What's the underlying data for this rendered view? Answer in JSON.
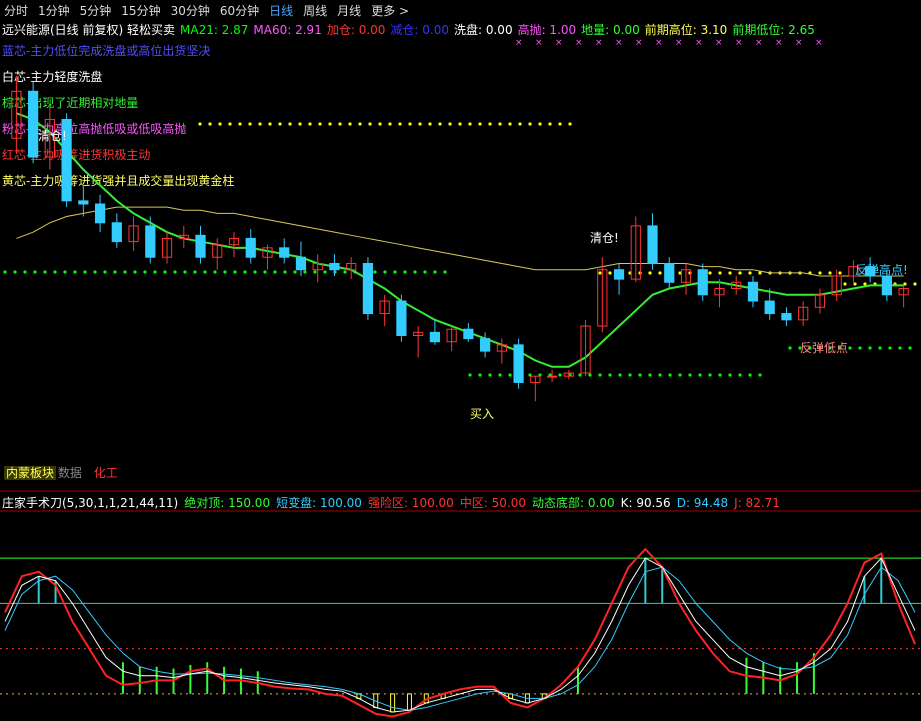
{
  "tabs": [
    "分时",
    "1分钟",
    "5分钟",
    "15分钟",
    "30分钟",
    "60分钟",
    "日线",
    "周线",
    "月线",
    "更多 >"
  ],
  "active_tab": "日线",
  "main_legend": {
    "title": "远兴能源(日线 前复权) 轻松买卖",
    "items": [
      {
        "label": "MA21: 2.87",
        "color": "#00ff00"
      },
      {
        "label": "MA60: 2.91",
        "color": "#ff55ff"
      },
      {
        "label": "加仓: 0.00",
        "color": "#ff3333"
      },
      {
        "label": "减仓: 0.00",
        "color": "#3333ff"
      },
      {
        "label": "洗盘: 0.00",
        "color": "#ffffff"
      },
      {
        "label": "高抛: 1.00",
        "color": "#ff55ff"
      },
      {
        "label": "地量: 0.00",
        "color": "#33ff33"
      },
      {
        "label": "前期高位: 3.10",
        "color": "#ffff55"
      },
      {
        "label": "前期低位: 2.65",
        "color": "#33ff33"
      }
    ]
  },
  "notes": [
    {
      "text": "蓝芯-主力低位完成洗盘或高位出货坚决",
      "color": "#4f4fff"
    },
    {
      "text": "白芯-主力轻度洗盘",
      "color": "#ffffff"
    },
    {
      "text": "棕芯-出现了近期相对地量",
      "color": "#33ee33"
    },
    {
      "text": "粉芯-主力高位高抛低吸或低吸高抛",
      "color": "#ff55ff"
    },
    {
      "text": "红芯-主力吸筹进货积极主动",
      "color": "#ff3333"
    },
    {
      "text": "黄芯-主力吸筹进货强并且成交量出现黄金柱",
      "color": "#ffff66"
    }
  ],
  "annotations": {
    "clear1": "清仓!",
    "clear2": "清仓!",
    "buy": "买入",
    "rebound_high": "反弹高点!",
    "rebound_low": "反弹低点"
  },
  "lower_tabs": {
    "t1": "内蒙板块",
    "t2": "数据",
    "t3": "化工"
  },
  "sub_legend": {
    "title": "庄家手术刀(5,30,1,1,21,44,11)",
    "items": [
      {
        "label": "绝对顶: 150.00",
        "color": "#33ff33"
      },
      {
        "label": "短变盘: 100.00",
        "color": "#33ccff"
      },
      {
        "label": "强险区: 100.00",
        "color": "#ff3333"
      },
      {
        "label": "中区: 50.00",
        "color": "#ff3333"
      },
      {
        "label": "动态底部: 0.00",
        "color": "#33ff33"
      },
      {
        "label": "K: 90.56",
        "color": "#ffffff"
      },
      {
        "label": "D: 94.48",
        "color": "#33ccff"
      },
      {
        "label": "J: 82.71",
        "color": "#ff3333"
      }
    ]
  },
  "chart_data": {
    "type": "candlestick",
    "price_candles": [
      [
        3.2,
        3.4,
        3.15,
        3.35
      ],
      [
        3.35,
        3.38,
        3.12,
        3.14
      ],
      [
        3.14,
        3.3,
        3.1,
        3.26
      ],
      [
        3.26,
        3.28,
        2.98,
        3.0
      ],
      [
        3.0,
        3.05,
        2.95,
        2.99
      ],
      [
        2.99,
        3.02,
        2.9,
        2.93
      ],
      [
        2.93,
        2.96,
        2.85,
        2.87
      ],
      [
        2.87,
        2.95,
        2.84,
        2.92
      ],
      [
        2.92,
        2.95,
        2.8,
        2.82
      ],
      [
        2.82,
        2.9,
        2.8,
        2.88
      ],
      [
        2.88,
        2.92,
        2.85,
        2.89
      ],
      [
        2.89,
        2.92,
        2.8,
        2.82
      ],
      [
        2.82,
        2.88,
        2.78,
        2.86
      ],
      [
        2.86,
        2.9,
        2.82,
        2.88
      ],
      [
        2.88,
        2.91,
        2.8,
        2.82
      ],
      [
        2.82,
        2.86,
        2.78,
        2.85
      ],
      [
        2.85,
        2.88,
        2.8,
        2.82
      ],
      [
        2.82,
        2.87,
        2.76,
        2.78
      ],
      [
        2.78,
        2.83,
        2.74,
        2.8
      ],
      [
        2.8,
        2.83,
        2.76,
        2.78
      ],
      [
        2.78,
        2.82,
        2.75,
        2.8
      ],
      [
        2.8,
        2.82,
        2.62,
        2.64
      ],
      [
        2.64,
        2.7,
        2.6,
        2.68
      ],
      [
        2.68,
        2.7,
        2.55,
        2.57
      ],
      [
        2.57,
        2.6,
        2.5,
        2.58
      ],
      [
        2.58,
        2.62,
        2.54,
        2.55
      ],
      [
        2.55,
        2.6,
        2.52,
        2.59
      ],
      [
        2.59,
        2.61,
        2.55,
        2.56
      ],
      [
        2.56,
        2.58,
        2.5,
        2.52
      ],
      [
        2.52,
        2.56,
        2.48,
        2.54
      ],
      [
        2.54,
        2.56,
        2.4,
        2.42
      ],
      [
        2.42,
        2.44,
        2.36,
        2.44
      ],
      [
        2.44,
        2.46,
        2.42,
        2.44
      ],
      [
        2.44,
        2.46,
        2.43,
        2.45
      ],
      [
        2.45,
        2.62,
        2.44,
        2.6
      ],
      [
        2.6,
        2.82,
        2.58,
        2.78
      ],
      [
        2.78,
        2.8,
        2.7,
        2.75
      ],
      [
        2.75,
        2.95,
        2.74,
        2.92
      ],
      [
        2.92,
        2.96,
        2.78,
        2.8
      ],
      [
        2.8,
        2.82,
        2.72,
        2.74
      ],
      [
        2.74,
        2.8,
        2.7,
        2.78
      ],
      [
        2.78,
        2.8,
        2.68,
        2.7
      ],
      [
        2.7,
        2.75,
        2.66,
        2.72
      ],
      [
        2.72,
        2.76,
        2.7,
        2.74
      ],
      [
        2.74,
        2.76,
        2.66,
        2.68
      ],
      [
        2.68,
        2.72,
        2.62,
        2.64
      ],
      [
        2.64,
        2.66,
        2.6,
        2.62
      ],
      [
        2.62,
        2.68,
        2.6,
        2.66
      ],
      [
        2.66,
        2.72,
        2.64,
        2.7
      ],
      [
        2.7,
        2.78,
        2.68,
        2.76
      ],
      [
        2.76,
        2.81,
        2.74,
        2.79
      ],
      [
        2.79,
        2.82,
        2.74,
        2.76
      ],
      [
        2.76,
        2.78,
        2.68,
        2.7
      ],
      [
        2.7,
        2.73,
        2.66,
        2.72
      ]
    ],
    "ma21": [
      3.28,
      3.26,
      3.22,
      3.16,
      3.1,
      3.05,
      3.0,
      2.96,
      2.93,
      2.9,
      2.88,
      2.87,
      2.86,
      2.85,
      2.85,
      2.84,
      2.83,
      2.82,
      2.8,
      2.79,
      2.78,
      2.75,
      2.72,
      2.68,
      2.65,
      2.62,
      2.6,
      2.58,
      2.56,
      2.54,
      2.52,
      2.49,
      2.47,
      2.47,
      2.5,
      2.55,
      2.6,
      2.65,
      2.7,
      2.72,
      2.73,
      2.74,
      2.74,
      2.73,
      2.72,
      2.71,
      2.7,
      2.7,
      2.7,
      2.71,
      2.72,
      2.73,
      2.73,
      2.73
    ],
    "ma60": [
      2.88,
      2.9,
      2.93,
      2.95,
      2.96,
      2.97,
      2.98,
      2.98,
      2.98,
      2.98,
      2.97,
      2.97,
      2.96,
      2.96,
      2.95,
      2.94,
      2.93,
      2.92,
      2.91,
      2.9,
      2.89,
      2.88,
      2.87,
      2.86,
      2.85,
      2.84,
      2.83,
      2.82,
      2.81,
      2.8,
      2.79,
      2.78,
      2.78,
      2.78,
      2.78,
      2.79,
      2.8,
      2.8,
      2.8,
      2.8,
      2.8,
      2.79,
      2.79,
      2.78,
      2.78,
      2.77,
      2.77,
      2.77,
      2.76,
      2.76,
      2.76,
      2.76,
      2.76,
      2.76
    ],
    "support_level": 2.65,
    "resistance_level": 3.1,
    "oscillator": {
      "K": [
        80,
        120,
        130,
        125,
        100,
        70,
        40,
        25,
        20,
        20,
        18,
        22,
        25,
        20,
        18,
        15,
        12,
        10,
        8,
        5,
        3,
        -5,
        -15,
        -20,
        -18,
        -10,
        -5,
        0,
        5,
        5,
        -5,
        -10,
        -5,
        5,
        20,
        45,
        80,
        120,
        150,
        140,
        110,
        80,
        60,
        40,
        30,
        25,
        20,
        25,
        35,
        50,
        80,
        130,
        150,
        110,
        70
      ],
      "D": [
        70,
        110,
        125,
        130,
        115,
        90,
        65,
        45,
        30,
        25,
        22,
        22,
        23,
        22,
        20,
        18,
        15,
        12,
        10,
        8,
        5,
        0,
        -8,
        -15,
        -18,
        -15,
        -10,
        -5,
        0,
        3,
        0,
        -5,
        -5,
        0,
        10,
        30,
        60,
        100,
        135,
        140,
        125,
        100,
        80,
        60,
        45,
        35,
        28,
        27,
        30,
        40,
        65,
        110,
        140,
        125,
        90
      ],
      "J": [
        90,
        130,
        135,
        120,
        80,
        50,
        20,
        10,
        12,
        15,
        15,
        25,
        28,
        15,
        15,
        12,
        8,
        6,
        5,
        0,
        -2,
        -12,
        -22,
        -25,
        -20,
        -6,
        0,
        5,
        8,
        8,
        -10,
        -15,
        -5,
        10,
        30,
        60,
        100,
        140,
        160,
        140,
        100,
        70,
        45,
        25,
        20,
        18,
        15,
        22,
        40,
        65,
        100,
        145,
        155,
        100,
        55
      ],
      "levels": [
        150,
        100,
        50,
        0
      ]
    }
  }
}
